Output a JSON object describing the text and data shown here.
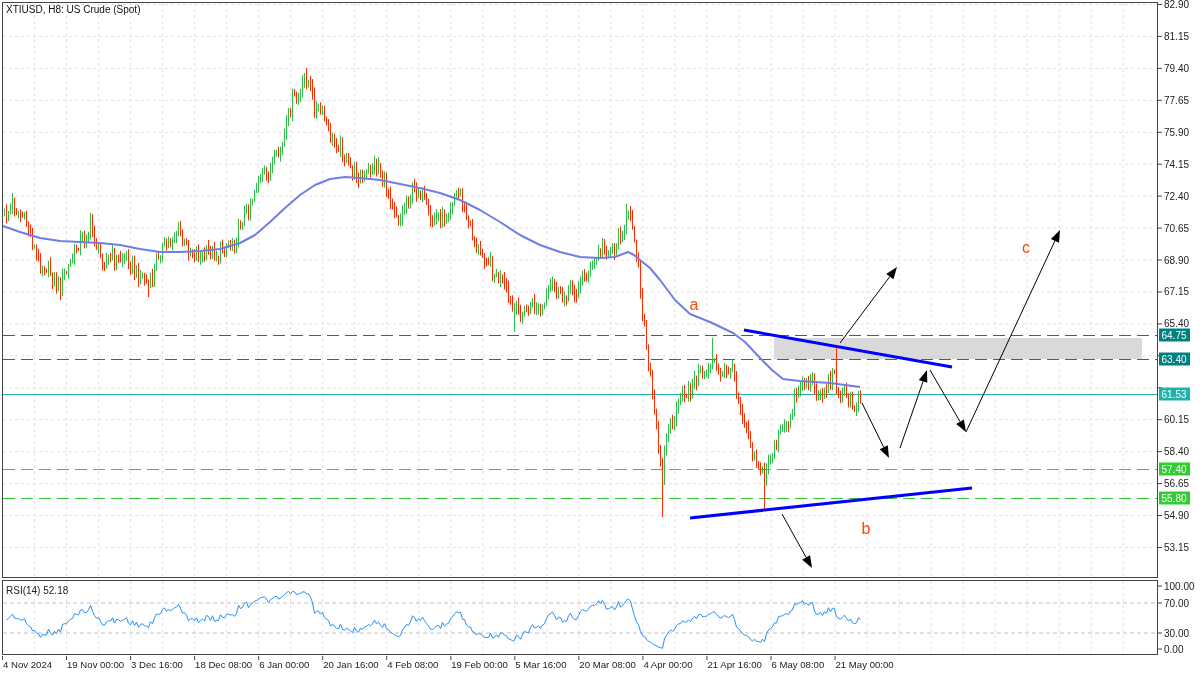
{
  "chart": {
    "title": "XTIUSD, H8: US Crude (Spot)",
    "wave_labels": [
      "a",
      "b",
      "c"
    ]
  },
  "price_axis": {
    "upper_ticks": [
      "82.90",
      "81.15",
      "79.40",
      "77.65",
      "75.90",
      "74.15",
      "72.40",
      "70.65",
      "68.90",
      "67.15",
      "65.40"
    ],
    "lower_ticks": [
      "60.15",
      "58.40",
      "56.65",
      "54.90",
      "53.15"
    ]
  },
  "levels": [
    {
      "label": "64.75",
      "kind": "dashed",
      "color": "#008080"
    },
    {
      "label": "63.40",
      "kind": "dashed",
      "color": "#008080"
    },
    {
      "label": "61.53",
      "kind": "solid",
      "color": "#20b2aa"
    },
    {
      "label": "57.40",
      "kind": "dashed",
      "color": "#32cd32"
    },
    {
      "label": "55.80",
      "kind": "dashed",
      "color": "#32cd32"
    }
  ],
  "rsi": {
    "label": "RSI(14) 52.18",
    "ticks": [
      "100.00",
      "70.00",
      "30.00",
      "0.00"
    ]
  },
  "time_axis": {
    "labels": [
      "4 Nov 2024",
      "19 Nov 00:00",
      "3 Dec 16:00",
      "18 Dec 08:00",
      "6 Jan 00:00",
      "20 Jan 16:00",
      "4 Feb 08:00",
      "19 Feb 00:00",
      "5 Mar 16:00",
      "20 Mar 08:00",
      "4 Apr 00:00",
      "21 Apr 16:00",
      "6 May 08:00",
      "21 May 00:00"
    ]
  }
}
